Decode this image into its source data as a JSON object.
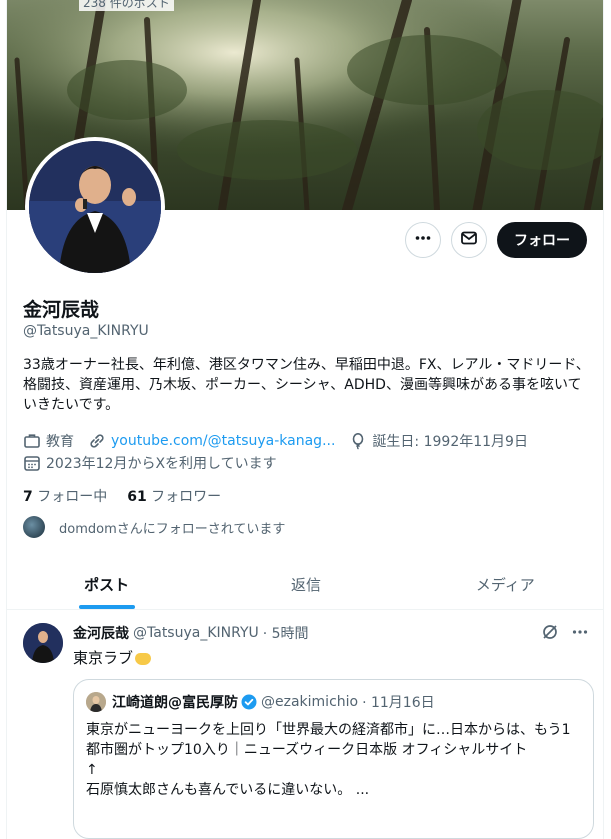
{
  "header": {
    "post_count": "238 件のポスト"
  },
  "profile": {
    "name": "金河辰哉",
    "handle": "@Tatsuya_KINRYU",
    "bio": "33歳オーナー社長、年利億、港区タワマン住み、早稲田中退。FX、レアル・マドリード、格闘技、資産運用、乃木坂、ポーカー、シーシャ、ADHD、漫画等興味がある事を呟いていきたいです。",
    "category": "教育",
    "website": "youtube.com/@tatsuya-kanag...",
    "birthday": "誕生日: 1992年11月9日",
    "joined": "2023年12月からXを利用しています",
    "following_count": "7",
    "following_label": "フォロー中",
    "followers_count": "61",
    "followers_label": "フォロワー",
    "followed_by": "domdomさんにフォローされています"
  },
  "actions": {
    "more_icon": "more-icon",
    "message_icon": "envelope-icon",
    "follow_label": "フォロー"
  },
  "tabs": [
    {
      "label": "ポスト",
      "active": true
    },
    {
      "label": "返信",
      "active": false
    },
    {
      "label": "メディア",
      "active": false
    }
  ],
  "tweet": {
    "author_name": "金河辰哉",
    "author_handle": "@Tatsuya_KINRYU",
    "time": "· 5時間",
    "text": "東京ラブ",
    "quote": {
      "author_name": "江崎道朗@富民厚防",
      "author_handle": "@ezakimichio",
      "time": "· 11月16日",
      "lines": [
        "東京がニューヨークを上回り「世界最大の経済都市」に…日本からは、もう1都市圏がトップ10入り｜ニューズウィーク日本版 オフィシャルサイト",
        "↑",
        "石原慎太郎さんも喜んでいるに違いない。 ..."
      ]
    }
  },
  "colors": {
    "accent": "#1d9bf0",
    "text": "#0f1419",
    "muted": "#536471",
    "border": "#cfd9de"
  }
}
